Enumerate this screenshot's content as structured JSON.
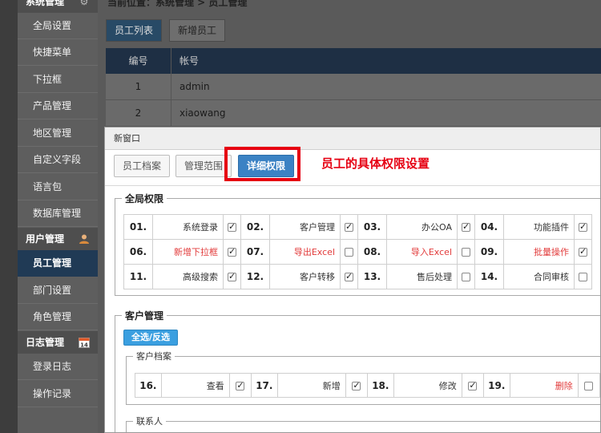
{
  "sidebar": {
    "group_system": "系统管理",
    "system_items": [
      "全局设置",
      "快捷菜单",
      "下拉框",
      "产品管理",
      "地区管理",
      "自定义字段",
      "语言包",
      "数据库管理"
    ],
    "group_user": "用户管理",
    "user_items": [
      "员工管理",
      "部门设置",
      "角色管理"
    ],
    "group_log": "日志管理",
    "log_items": [
      "登录日志",
      "操作记录"
    ],
    "active": "员工管理",
    "icons": {
      "system": "gear-icon",
      "user": "user-icon",
      "log": "calendar-icon"
    },
    "calendar_day": "14"
  },
  "breadcrumb": "当前位置：系统管理 > 员工管理",
  "bg_tabs": [
    "员工列表",
    "新增员工"
  ],
  "bg_table": {
    "columns": [
      "编号",
      "帐号"
    ],
    "rows": [
      [
        "1",
        "admin"
      ],
      [
        "2",
        "xiaowang"
      ]
    ]
  },
  "modal": {
    "title": "新窗口",
    "tabs": [
      "员工档案",
      "管理范围",
      "详细权限"
    ],
    "active_tab": "详细权限",
    "annotation": "员工的具体权限设置",
    "global_section": {
      "legend": "全局权限",
      "items": [
        {
          "num": "01.",
          "label": "系统登录",
          "checked": true,
          "red": false
        },
        {
          "num": "02.",
          "label": "客户管理",
          "checked": true,
          "red": false
        },
        {
          "num": "03.",
          "label": "办公OA",
          "checked": true,
          "red": false
        },
        {
          "num": "04.",
          "label": "功能插件",
          "checked": true,
          "red": false
        },
        {
          "num": "06.",
          "label": "新增下拉框",
          "checked": true,
          "red": true
        },
        {
          "num": "07.",
          "label": "导出Excel",
          "checked": false,
          "red": true
        },
        {
          "num": "08.",
          "label": "导入Excel",
          "checked": false,
          "red": true
        },
        {
          "num": "09.",
          "label": "批量操作",
          "checked": true,
          "red": true
        },
        {
          "num": "11.",
          "label": "高级搜索",
          "checked": true,
          "red": false
        },
        {
          "num": "12.",
          "label": "客户转移",
          "checked": true,
          "red": false
        },
        {
          "num": "13.",
          "label": "售后处理",
          "checked": false,
          "red": false
        },
        {
          "num": "14.",
          "label": "合同审核",
          "checked": false,
          "red": false
        }
      ]
    },
    "customer_section": {
      "legend": "客户管理",
      "select_all": "全选/反选",
      "archive": {
        "legend": "客户档案",
        "items": [
          {
            "num": "16.",
            "label": "查看",
            "checked": true,
            "red": false
          },
          {
            "num": "17.",
            "label": "新增",
            "checked": true,
            "red": false
          },
          {
            "num": "18.",
            "label": "修改",
            "checked": true,
            "red": false
          },
          {
            "num": "19.",
            "label": "删除",
            "checked": false,
            "red": true
          }
        ]
      },
      "contact_legend": "联系人"
    }
  },
  "colors": {
    "accent_blue": "#3b82c4",
    "highlight_red": "#e60012",
    "active_sidebar": "#203a55"
  }
}
